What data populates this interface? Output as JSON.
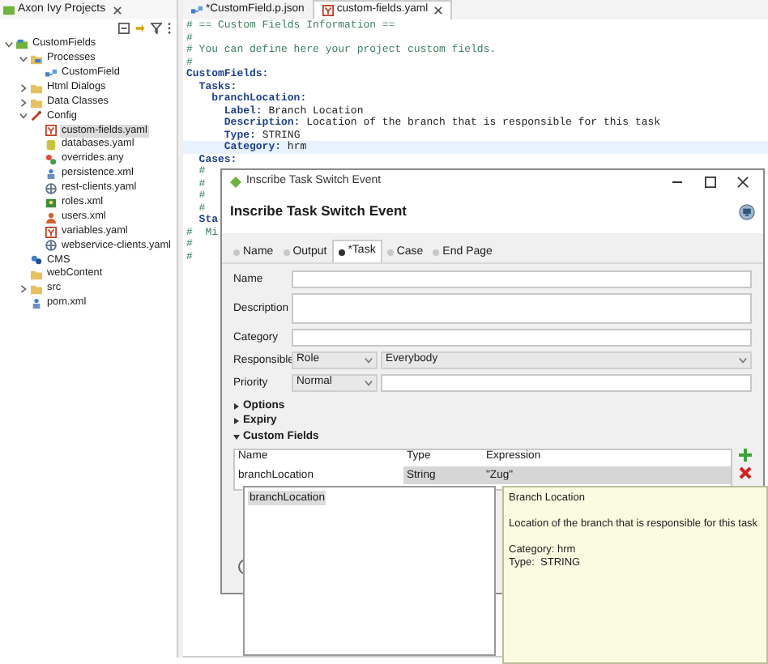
{
  "explorer": {
    "title": "Axon Ivy Projects",
    "tree": [
      {
        "label": "CustomFields",
        "kind": "project",
        "expanded": true,
        "selected": false,
        "children": [
          {
            "label": "Processes",
            "kind": "process-folder",
            "expanded": true,
            "selected": false,
            "children": [
              {
                "label": "CustomField",
                "kind": "process",
                "selected": false
              }
            ]
          },
          {
            "label": "Html Dialogs",
            "kind": "folder",
            "expanded": false,
            "selected": false
          },
          {
            "label": "Data Classes",
            "kind": "folder",
            "expanded": false,
            "selected": false
          },
          {
            "label": "Config",
            "kind": "config",
            "expanded": true,
            "selected": false,
            "children": [
              {
                "label": "custom-fields.yaml",
                "kind": "yaml",
                "selected": true
              },
              {
                "label": "databases.yaml",
                "kind": "database",
                "selected": false
              },
              {
                "label": "overrides.any",
                "kind": "file",
                "selected": false
              },
              {
                "label": "persistence.xml",
                "kind": "xml",
                "selected": false
              },
              {
                "label": "rest-clients.yaml",
                "kind": "web",
                "selected": false
              },
              {
                "label": "roles.xml",
                "kind": "roles",
                "selected": false
              },
              {
                "label": "users.xml",
                "kind": "users",
                "selected": false
              },
              {
                "label": "variables.yaml",
                "kind": "yaml",
                "selected": false
              },
              {
                "label": "webservice-clients.yaml",
                "kind": "web",
                "selected": false
              }
            ]
          },
          {
            "label": "CMS",
            "kind": "cms",
            "selected": false
          },
          {
            "label": "webContent",
            "kind": "folder",
            "selected": false
          },
          {
            "label": "src",
            "kind": "folder",
            "expanded": false,
            "selected": false
          },
          {
            "label": "pom.xml",
            "kind": "xml",
            "selected": false
          }
        ]
      }
    ]
  },
  "editor_tabs": [
    {
      "label": "*CustomField.p.json",
      "kind": "process",
      "selected": false
    },
    {
      "label": "custom-fields.yaml",
      "kind": "yaml",
      "selected": true
    }
  ],
  "code_lines": [
    {
      "kind": "comment",
      "text": "# == Custom Fields Information ==",
      "highlighted": false
    },
    {
      "kind": "comment",
      "text": "#",
      "highlighted": false
    },
    {
      "kind": "comment",
      "text": "# You can define here your project custom fields.",
      "highlighted": false
    },
    {
      "kind": "comment",
      "text": "#",
      "highlighted": false
    },
    {
      "kind": "entry",
      "key": "CustomFields:",
      "highlighted": false
    },
    {
      "kind": "entry",
      "key": "  Tasks:",
      "highlighted": false
    },
    {
      "kind": "entry",
      "key": "    branchLocation:",
      "highlighted": false
    },
    {
      "kind": "entry",
      "key": "      Label:",
      "value": " Branch Location",
      "highlighted": false
    },
    {
      "kind": "entry",
      "key": "      Description:",
      "value": " Location of the branch that is responsible for this task",
      "highlighted": false
    },
    {
      "kind": "entry",
      "key": "      Type:",
      "value": " STRING",
      "highlighted": false
    },
    {
      "kind": "entry",
      "key": "      Category:",
      "value": " hrm",
      "highlighted": true
    },
    {
      "kind": "entry",
      "key": "  Cases:",
      "highlighted": false
    },
    {
      "kind": "comment",
      "text": "  #",
      "highlighted": false
    },
    {
      "kind": "comment",
      "text": "  #",
      "highlighted": false
    },
    {
      "kind": "comment",
      "text": "  #",
      "highlighted": false
    },
    {
      "kind": "comment",
      "text": "  #",
      "highlighted": false
    },
    {
      "kind": "entry",
      "key": "  Sta",
      "highlighted": false
    },
    {
      "kind": "comment",
      "text": "#  Mi",
      "highlighted": false
    },
    {
      "kind": "comment",
      "text": "#",
      "highlighted": false
    },
    {
      "kind": "comment",
      "text": "#",
      "highlighted": false
    }
  ],
  "dialog": {
    "title": "Inscribe Task Switch Event",
    "heading": "Inscribe Task Switch Event",
    "tabs": [
      {
        "label": "Name",
        "selected": false
      },
      {
        "label": "Output",
        "selected": false
      },
      {
        "label": "*Task",
        "selected": true
      },
      {
        "label": "Case",
        "selected": false
      },
      {
        "label": "End Page",
        "selected": false
      }
    ],
    "fields": [
      {
        "label": "Name",
        "kind": "text"
      },
      {
        "label": "Description",
        "kind": "textarea"
      },
      {
        "label": "Category",
        "kind": "text"
      },
      {
        "label": "Responsible",
        "kind": "responsible",
        "type": "Role",
        "value": "Everybody"
      },
      {
        "label": "Priority",
        "kind": "priority",
        "value": "Normal"
      }
    ],
    "sections": [
      {
        "label": "Options",
        "expanded": false
      },
      {
        "label": "Expiry",
        "expanded": false
      },
      {
        "label": "Custom Fields",
        "expanded": true
      }
    ],
    "custom_fields_table": {
      "columns": [
        "Name",
        "Type",
        "Expression"
      ],
      "rows": [
        {
          "cells": [
            "branchLocation",
            "String",
            "\"Zug\""
          ],
          "selected": true
        }
      ]
    }
  },
  "autocomplete": {
    "items": [
      {
        "label": "branchLocation",
        "selected": true
      }
    ]
  },
  "tooltip": {
    "title": "Branch Location",
    "description": "Location of the branch that is responsible for this task",
    "category": "Category: hrm",
    "type": "Type:  STRING"
  }
}
